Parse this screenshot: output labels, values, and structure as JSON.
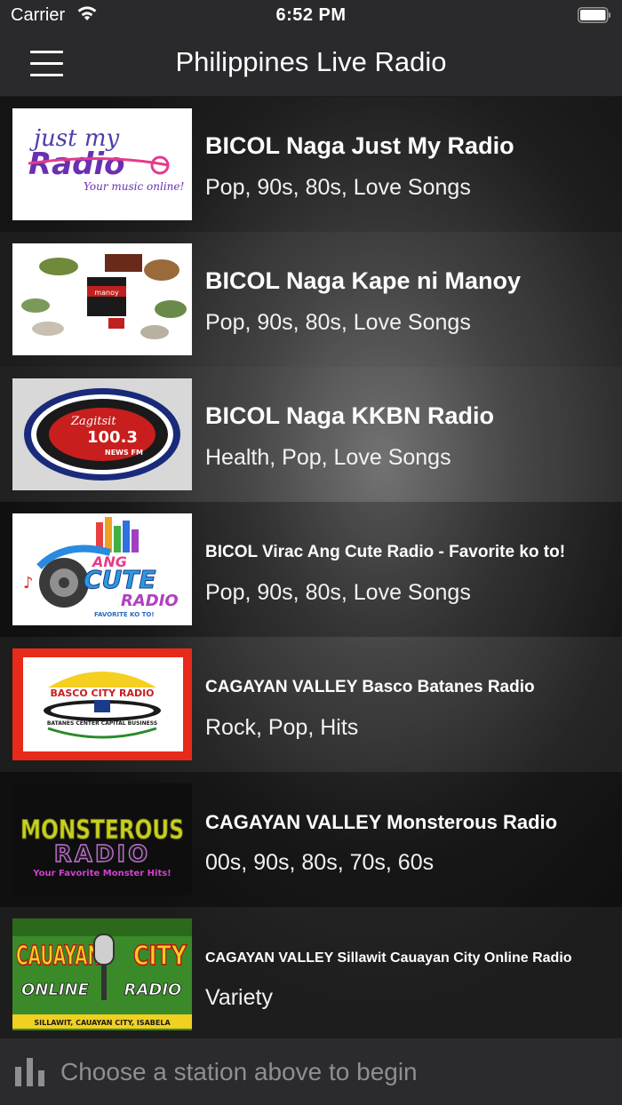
{
  "status": {
    "carrier": "Carrier",
    "time": "6:52 PM"
  },
  "nav": {
    "title": "Philippines Live Radio"
  },
  "stations": [
    {
      "name": "BICOL Naga Just My Radio",
      "genres": "Pop, 90s, 80s, Love Songs",
      "logo_text_1": "just my",
      "logo_text_2": "Radio",
      "logo_text_3": "Your music online!"
    },
    {
      "name": "BICOL Naga Kape ni Manoy",
      "genres": "Pop, 90s, 80s, Love Songs",
      "logo_text_1": "manoy"
    },
    {
      "name": "BICOL Naga KKBN Radio",
      "genres": "Health, Pop, Love Songs",
      "logo_text_1": "Zagitsit",
      "logo_text_2": "100.3",
      "logo_text_3": "NEWS FM"
    },
    {
      "name": "BICOL Virac Ang Cute Radio - Favorite ko to!",
      "genres": "Pop, 90s, 80s, Love Songs",
      "logo_text_1": "ANG",
      "logo_text_2": "CUTE",
      "logo_text_3": "RADIO",
      "logo_text_4": "FAVORITE KO TO!"
    },
    {
      "name": "CAGAYAN VALLEY Basco Batanes Radio",
      "genres": "Rock, Pop, Hits",
      "logo_text_1": "BASCO CITY RADIO",
      "logo_text_2": "BATANES CENTER CAPITAL BUSINESS"
    },
    {
      "name": "CAGAYAN VALLEY Monsterous Radio",
      "genres": "00s, 90s, 80s, 70s, 60s",
      "logo_text_1": "MONSTEROUS",
      "logo_text_2": "RADIO",
      "logo_text_3": "Your Favorite Monster Hits!"
    },
    {
      "name": "CAGAYAN VALLEY Sillawit Cauayan City Online Radio",
      "genres": "Variety",
      "logo_text_1": "CAUAYAN",
      "logo_text_2": "CITY",
      "logo_text_3": "ONLINE",
      "logo_text_4": "RADIO",
      "logo_text_5": "SILLAWIT, CAUAYAN CITY, ISABELA"
    }
  ],
  "player": {
    "message": "Choose a station above to begin"
  },
  "colors": {
    "nav_bg": "#2a2a2c",
    "player_text": "#8e8e93"
  }
}
